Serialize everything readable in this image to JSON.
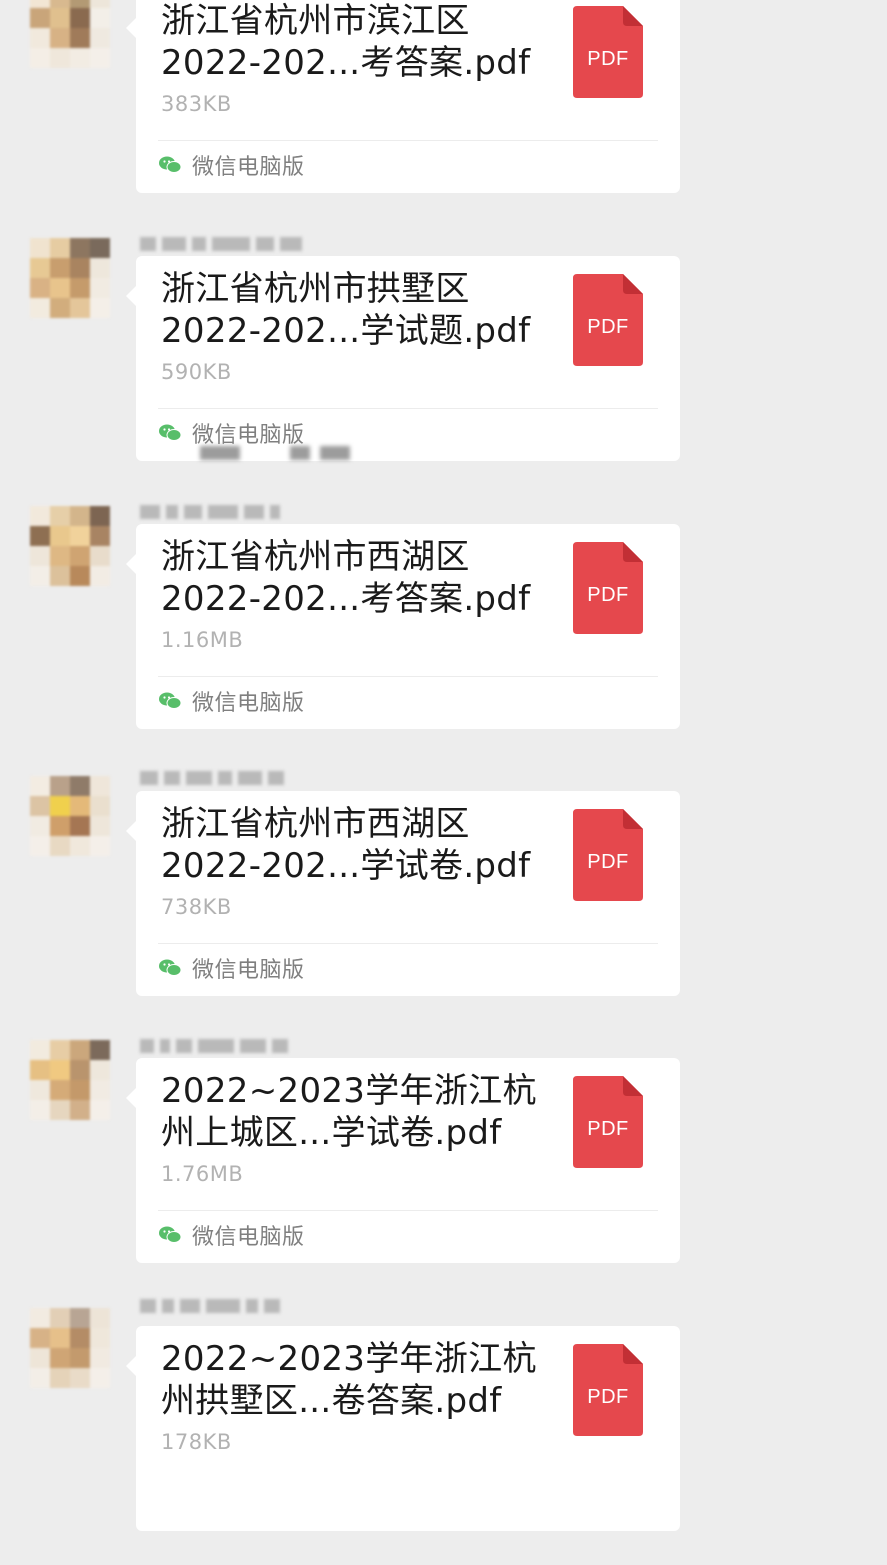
{
  "chat": {
    "source_label": "微信电脑版",
    "pdf_badge": "PDF",
    "colors": {
      "background": "#ededed",
      "bubble": "#ffffff",
      "pdf_red": "#e5484d",
      "wechat_green": "#58be6a",
      "size_text": "#b2b2b2"
    },
    "messages": [
      {
        "file_name": "浙江省杭州市滨江区\n2022-202...考答案.pdf",
        "file_size": "383KB"
      },
      {
        "file_name": "浙江省杭州市拱墅区\n2022-202...学试题.pdf",
        "file_size": "590KB"
      },
      {
        "file_name": "浙江省杭州市西湖区\n2022-202...考答案.pdf",
        "file_size": "1.16MB"
      },
      {
        "file_name": "浙江省杭州市西湖区\n2022-202...学试卷.pdf",
        "file_size": "738KB"
      },
      {
        "file_name": "2022~2023学年浙江杭\n州上城区...学试卷.pdf",
        "file_size": "1.76MB"
      },
      {
        "file_name": "2022~2023学年浙江杭\n州拱墅区...卷答案.pdf",
        "file_size": "178KB"
      }
    ]
  }
}
